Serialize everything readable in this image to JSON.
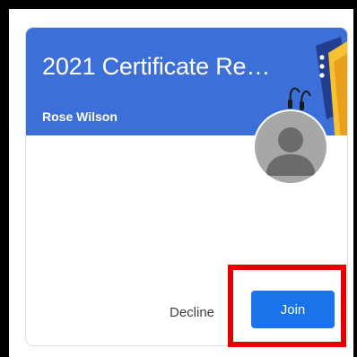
{
  "invite_card": {
    "title": "2021 Certificate Rene...",
    "owner": "Rose Wilson",
    "decline_label": "Decline",
    "join_label": "Join",
    "more_icon": "more-vert-icon",
    "avatar_icon": "person-avatar-icon"
  },
  "colors": {
    "banner": "#3d6fd9",
    "join_button": "#1a73e8",
    "highlight": "#e00000"
  }
}
